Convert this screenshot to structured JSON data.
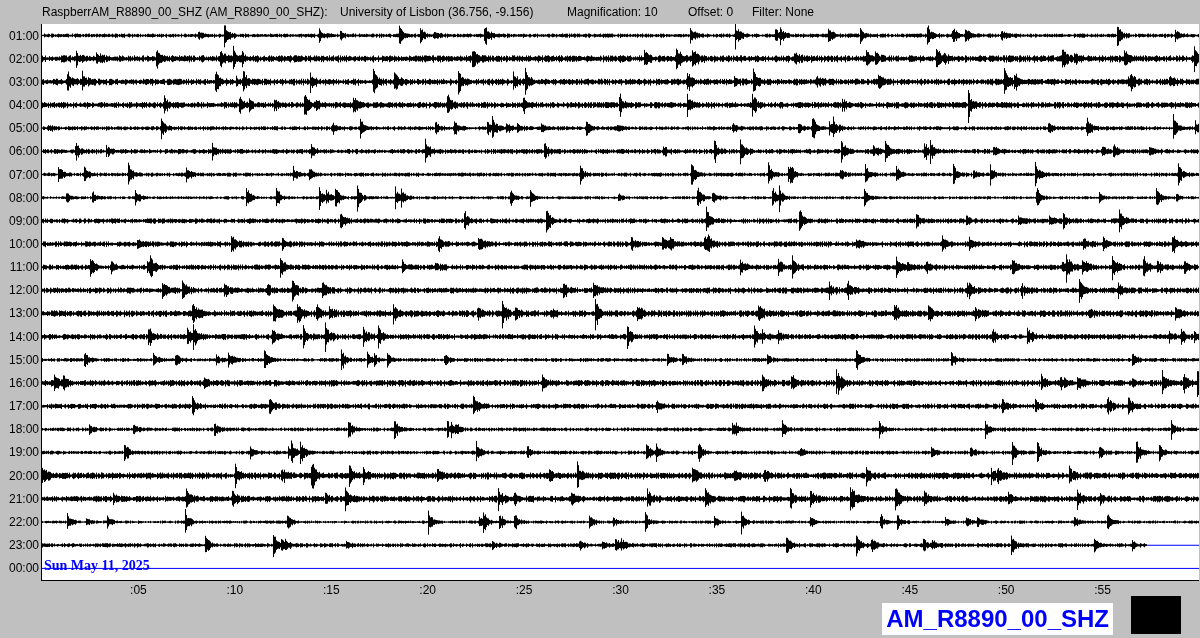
{
  "header": {
    "station": "RaspberrAM_R8890_00_SHZ (AM_R8890_00_SHZ):",
    "location": "University of Lisbon (36.756, -9.156)",
    "magnification": "Magnification: 10",
    "offset": "Offset: 0",
    "filter": "Filter: None"
  },
  "rows": [
    {
      "hour": "01:00",
      "kind": "trace"
    },
    {
      "hour": "02:00",
      "kind": "trace"
    },
    {
      "hour": "03:00",
      "kind": "trace"
    },
    {
      "hour": "04:00",
      "kind": "trace"
    },
    {
      "hour": "05:00",
      "kind": "trace"
    },
    {
      "hour": "06:00",
      "kind": "trace"
    },
    {
      "hour": "07:00",
      "kind": "trace"
    },
    {
      "hour": "08:00",
      "kind": "trace"
    },
    {
      "hour": "09:00",
      "kind": "trace"
    },
    {
      "hour": "10:00",
      "kind": "trace"
    },
    {
      "hour": "11:00",
      "kind": "trace"
    },
    {
      "hour": "12:00",
      "kind": "trace"
    },
    {
      "hour": "13:00",
      "kind": "trace"
    },
    {
      "hour": "14:00",
      "kind": "trace"
    },
    {
      "hour": "15:00",
      "kind": "trace"
    },
    {
      "hour": "16:00",
      "kind": "trace"
    },
    {
      "hour": "17:00",
      "kind": "trace"
    },
    {
      "hour": "18:00",
      "kind": "trace"
    },
    {
      "hour": "19:00",
      "kind": "trace"
    },
    {
      "hour": "20:00",
      "kind": "trace"
    },
    {
      "hour": "21:00",
      "kind": "trace"
    },
    {
      "hour": "22:00",
      "kind": "trace"
    },
    {
      "hour": "23:00",
      "kind": "partial"
    },
    {
      "hour": "00:00",
      "kind": "empty"
    }
  ],
  "date": "Sun May 11, 2025",
  "minute_ticks": [
    ":05",
    ":10",
    ":15",
    ":20",
    ":25",
    ":30",
    ":35",
    ":40",
    ":45",
    ":50",
    ":55"
  ],
  "station_label": "AM_R8890_00_SHZ"
}
